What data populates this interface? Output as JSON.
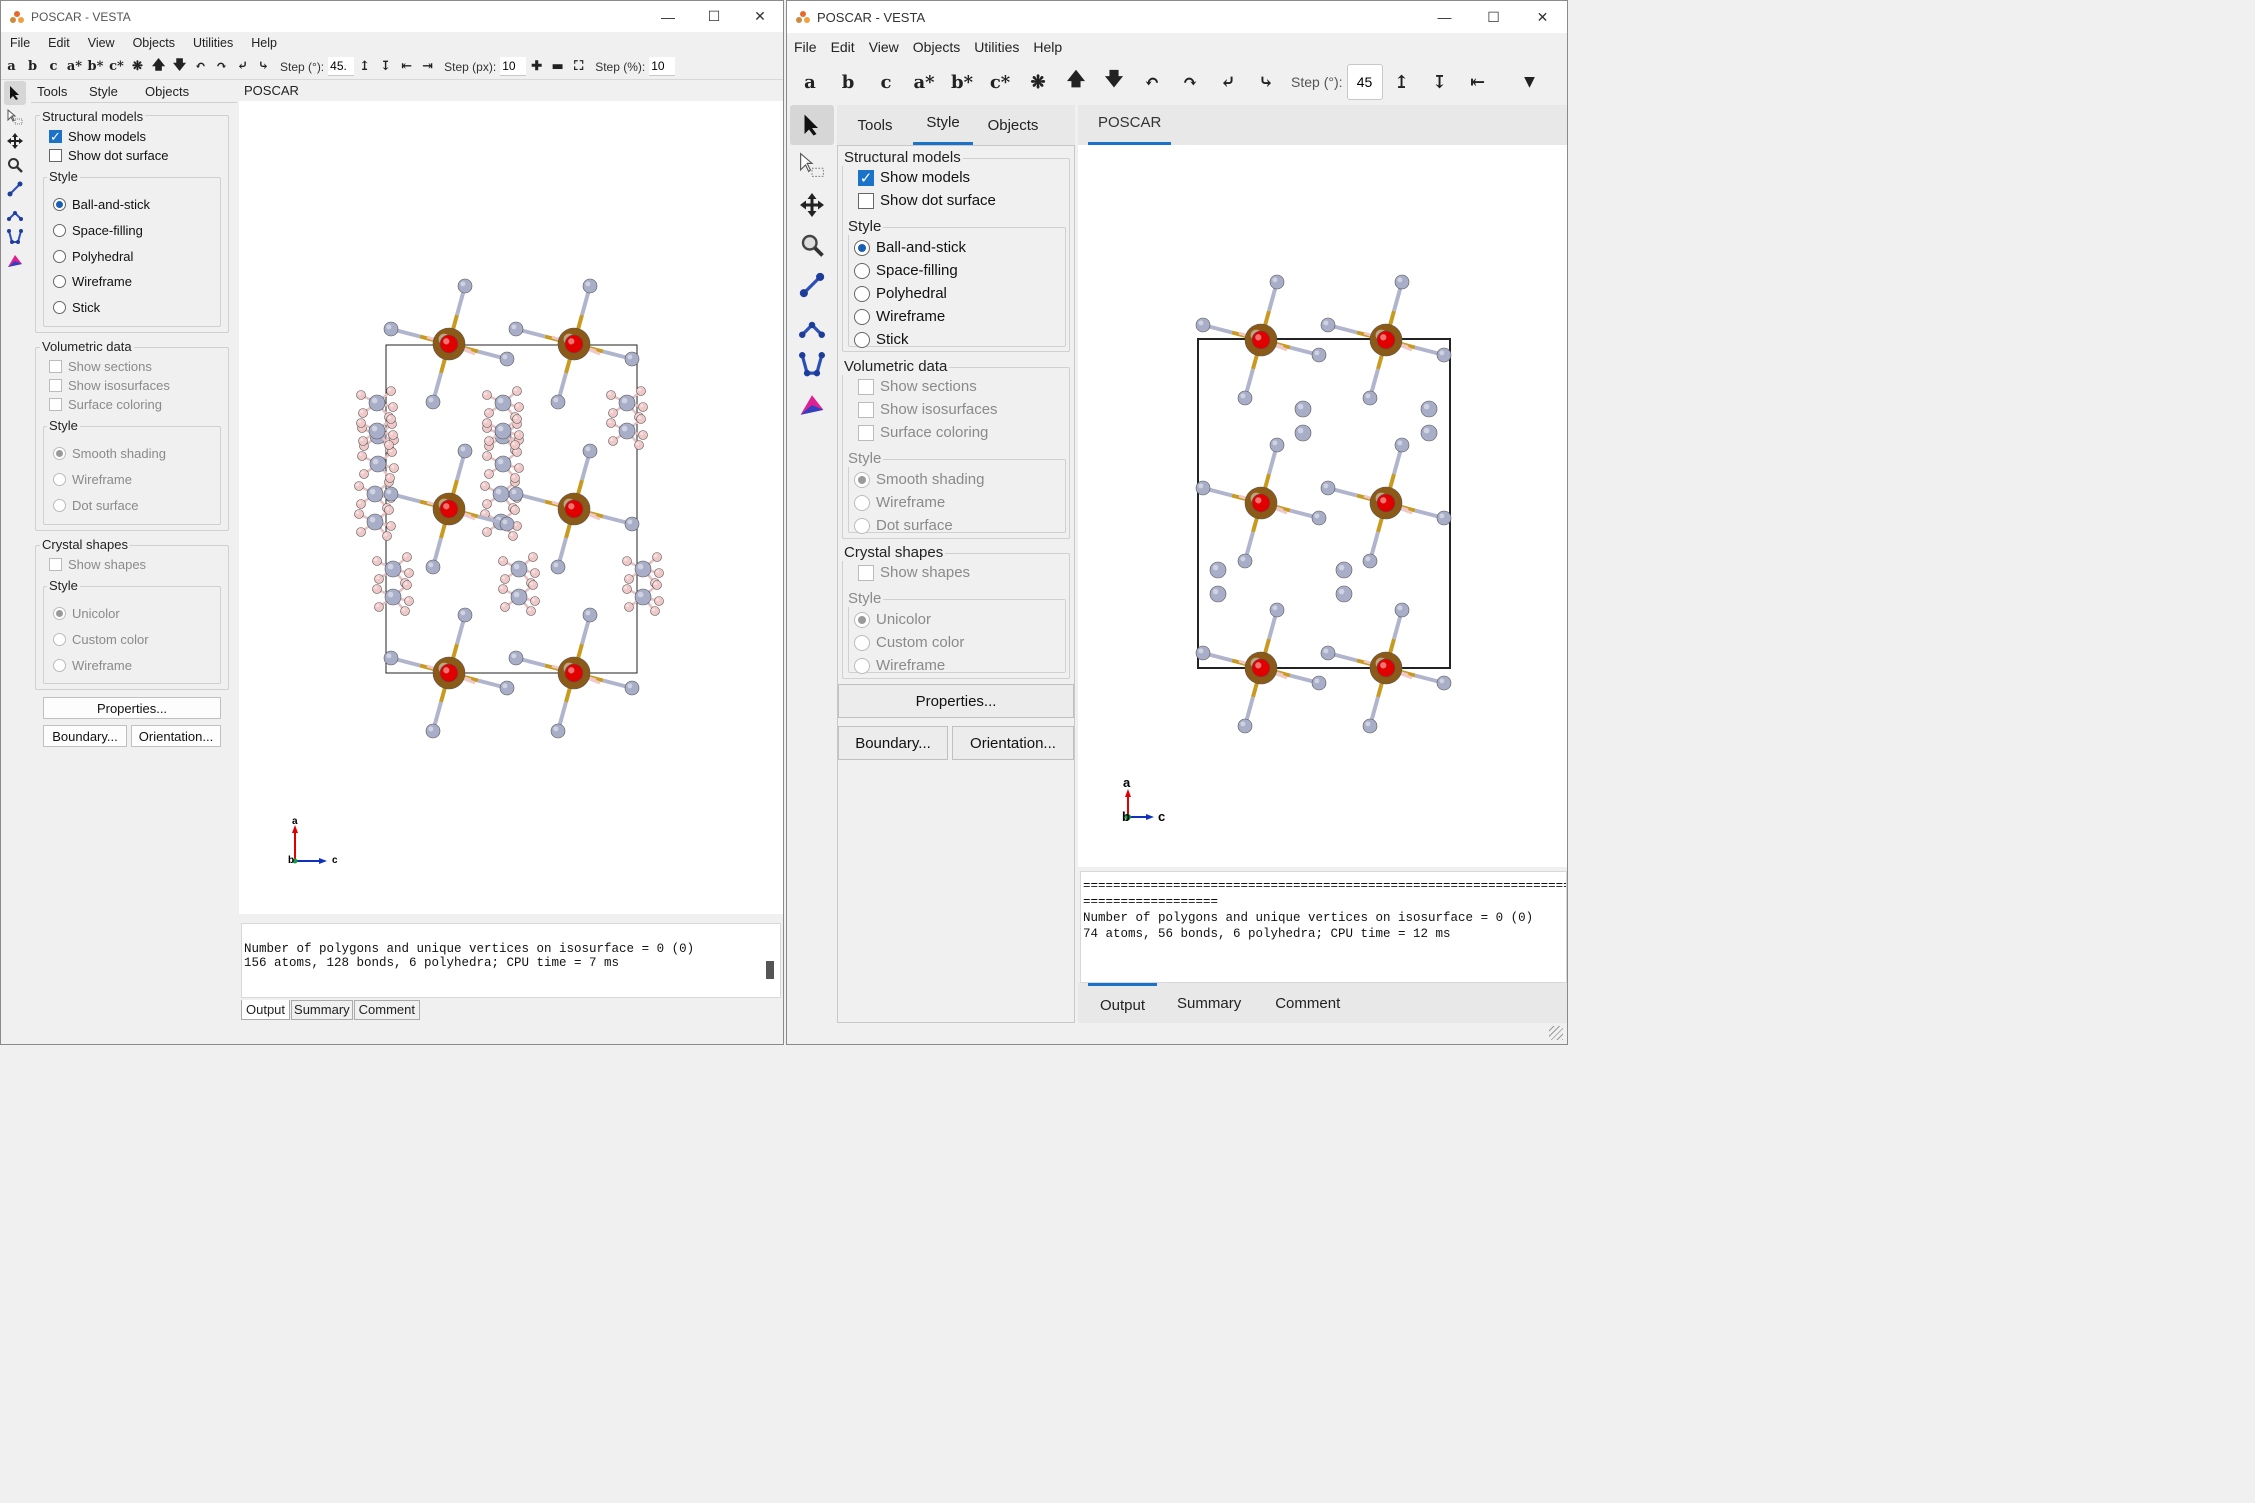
{
  "left": {
    "title": "POSCAR - VESTA",
    "menu": [
      "File",
      "Edit",
      "View",
      "Objects",
      "Utilities",
      "Help"
    ],
    "toolbar": {
      "axes": [
        "a",
        "b",
        "c",
        "a*",
        "b*",
        "c*"
      ],
      "step_deg_label": "Step (°):",
      "step_deg_value": "45.",
      "step_px_label": "Step (px):",
      "step_px_value": "10",
      "step_pct_label": "Step (%):",
      "step_pct_value": "10"
    },
    "panel_tabs": [
      "Tools",
      "Style",
      "Objects"
    ],
    "active_panel_tab": "Style",
    "structural": {
      "title": "Structural models",
      "show_models": "Show models",
      "show_dot_surface": "Show dot surface",
      "style_title": "Style",
      "styles": [
        "Ball-and-stick",
        "Space-filling",
        "Polyhedral",
        "Wireframe",
        "Stick"
      ]
    },
    "volumetric": {
      "title": "Volumetric data",
      "show_sections": "Show sections",
      "show_isosurfaces": "Show isosurfaces",
      "surface_coloring": "Surface coloring",
      "style_title": "Style",
      "styles": [
        "Smooth shading",
        "Wireframe",
        "Dot surface"
      ]
    },
    "crystal": {
      "title": "Crystal shapes",
      "show_shapes": "Show shapes",
      "style_title": "Style",
      "styles": [
        "Unicolor",
        "Custom color",
        "Wireframe"
      ]
    },
    "buttons": {
      "properties": "Properties...",
      "boundary": "Boundary...",
      "orientation": "Orientation..."
    },
    "view_tab": "POSCAR",
    "axis_labels": {
      "a": "a",
      "b": "b",
      "c": "c"
    },
    "console": [
      "Number of polygons and unique vertices on isosurface = 0 (0)",
      "156 atoms, 128 bonds, 6 polyhedra; CPU time = 7 ms"
    ],
    "bottom_tabs": [
      "Output",
      "Summary",
      "Comment"
    ]
  },
  "right": {
    "title": "POSCAR - VESTA",
    "menu": [
      "File",
      "Edit",
      "View",
      "Objects",
      "Utilities",
      "Help"
    ],
    "toolbar": {
      "axes": [
        "a",
        "b",
        "c",
        "a*",
        "b*",
        "c*"
      ],
      "step_deg_label": "Step (°):",
      "step_deg_value": "45"
    },
    "panel_tabs": [
      "Tools",
      "Style",
      "Objects"
    ],
    "active_panel_tab": "Style",
    "structural": {
      "title": "Structural models",
      "show_models": "Show models",
      "show_dot_surface": "Show dot surface",
      "style_title": "Style",
      "styles": [
        "Ball-and-stick",
        "Space-filling",
        "Polyhedral",
        "Wireframe",
        "Stick"
      ]
    },
    "volumetric": {
      "title": "Volumetric data",
      "show_sections": "Show sections",
      "show_isosurfaces": "Show isosurfaces",
      "surface_coloring": "Surface coloring",
      "style_title": "Style",
      "styles": [
        "Smooth shading",
        "Wireframe",
        "Dot surface"
      ]
    },
    "crystal": {
      "title": "Crystal shapes",
      "show_shapes": "Show shapes",
      "style_title": "Style",
      "styles": [
        "Unicolor",
        "Custom color",
        "Wireframe"
      ]
    },
    "buttons": {
      "properties": "Properties...",
      "boundary": "Boundary...",
      "orientation": "Orientation..."
    },
    "view_tab": "POSCAR",
    "axis_labels": {
      "a": "a",
      "b": "b",
      "c": "c"
    },
    "console": [
      "==========================================================================",
      "==================",
      "",
      "Number of polygons and unique vertices on isosurface = 0 (0)",
      "74 atoms, 56 bonds, 6 polyhedra; CPU time = 12 ms"
    ],
    "bottom_tabs": [
      "Output",
      "Summary",
      "Comment"
    ]
  },
  "colors": {
    "accent": "#1a73c8",
    "metal_atom": "#8b5a16",
    "center_atom": "#e00000",
    "nitrogen_atom": "#a8aec8",
    "hydrogen_atom": "#f0c8c8"
  }
}
